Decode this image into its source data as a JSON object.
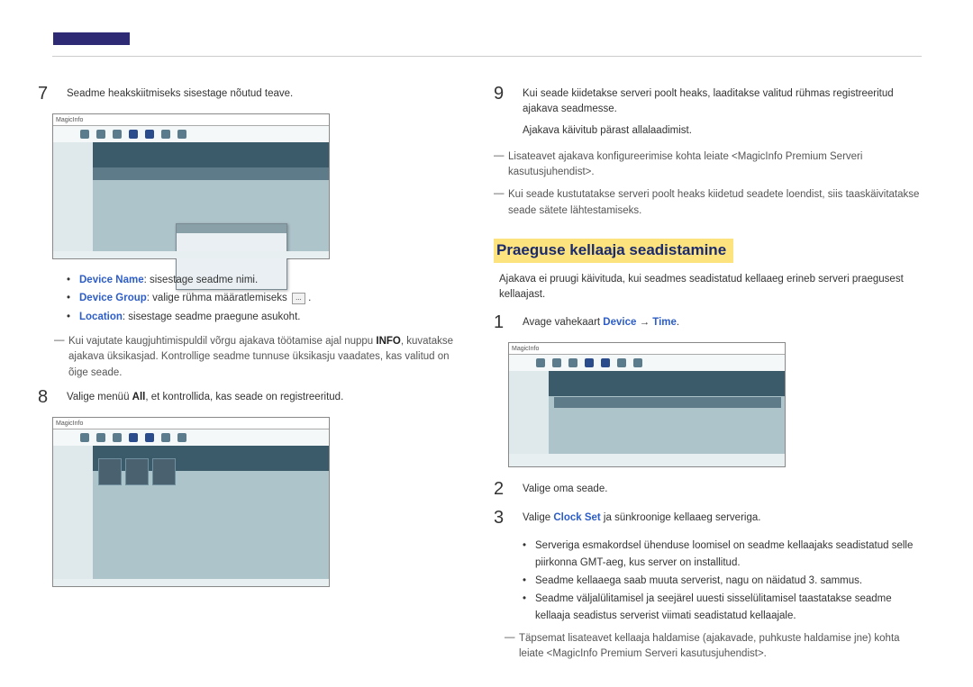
{
  "steps": {
    "s7": "Seadme heakskiitmiseks sisestage nõutud teave.",
    "s7_bullets": {
      "b1_label": "Device Name",
      "b1_text": ": sisestage seadme nimi.",
      "b2_label": "Device Group",
      "b2_text": ": valige rühma määratlemiseks",
      "b2_after": ".",
      "b3_label": "Location",
      "b3_text": ": sisestage seadme praegune asukoht."
    },
    "s7_dash": "Kui vajutate kaugjuhtimispuldil võrgu ajakava töötamise ajal nuppu INFO, kuvatakse ajakava üksikasjad. Kontrollige seadme tunnuse üksikasju vaadates, kas valitud on õige seade.",
    "s7_dash_pre": "Kui vajutate kaugjuhtimispuldil võrgu ajakava töötamise ajal nuppu ",
    "s7_dash_info": "INFO",
    "s7_dash_post": ", kuvatakse ajakava üksikasjad. Kontrollige seadme tunnuse üksikasju vaadates, kas valitud on õige seade.",
    "s8_pre": "Valige menüü ",
    "s8_bold": "All",
    "s8_post": ", et kontrollida, kas seade on registreeritud.",
    "s9_a": "Kui seade kiidetakse serveri poolt heaks, laaditakse valitud rühmas registreeritud ajakava seadmesse.",
    "s9_b": "Ajakava käivitub pärast allalaadimist.",
    "s9_dash1": "Lisateavet ajakava konfigureerimise kohta leiate <MagicInfo Premium Serveri kasutusjuhendist>.",
    "s9_dash2": "Kui seade kustutatakse serveri poolt heaks kiidetud seadete loendist, siis taaskäivitatakse seade sätete lähtestamiseks.",
    "section_title": "Praeguse kellaaja seadistamine",
    "section_para": "Ajakava ei pruugi käivituda, kui seadmes seadistatud kellaaeg erineb serveri praegusest kellaajast.",
    "s1_pre": "Avage vahekaart ",
    "s1_b1": "Device",
    "s1_arrow": " → ",
    "s1_b2": "Time",
    "s1_post": ".",
    "s2": "Valige oma seade.",
    "s3_pre": "Valige ",
    "s3_b": "Clock Set",
    "s3_post": " ja sünkroonige kellaaeg serveriga.",
    "s3_bullets": {
      "b1": "Serveriga esmakordsel ühenduse loomisel on seadme kellaajaks seadistatud selle piirkonna GMT-aeg, kus server on installitud.",
      "b2": "Seadme kellaaega saab muuta serverist, nagu on näidatud 3. sammus.",
      "b3": "Seadme väljalülitamisel ja seejärel uuesti sisselülitamisel taastatakse seadme kellaaja seadistus serverist viimati seadistatud kellaajale."
    },
    "s3_dash": "Täpsemat lisateavet kellaaja haldamise (ajakavade, puhkuste haldamise jne) kohta leiate <MagicInfo Premium Serveri kasutusjuhendist>."
  },
  "ui": {
    "logo": "MagicInfo",
    "ellipsis": "..."
  }
}
